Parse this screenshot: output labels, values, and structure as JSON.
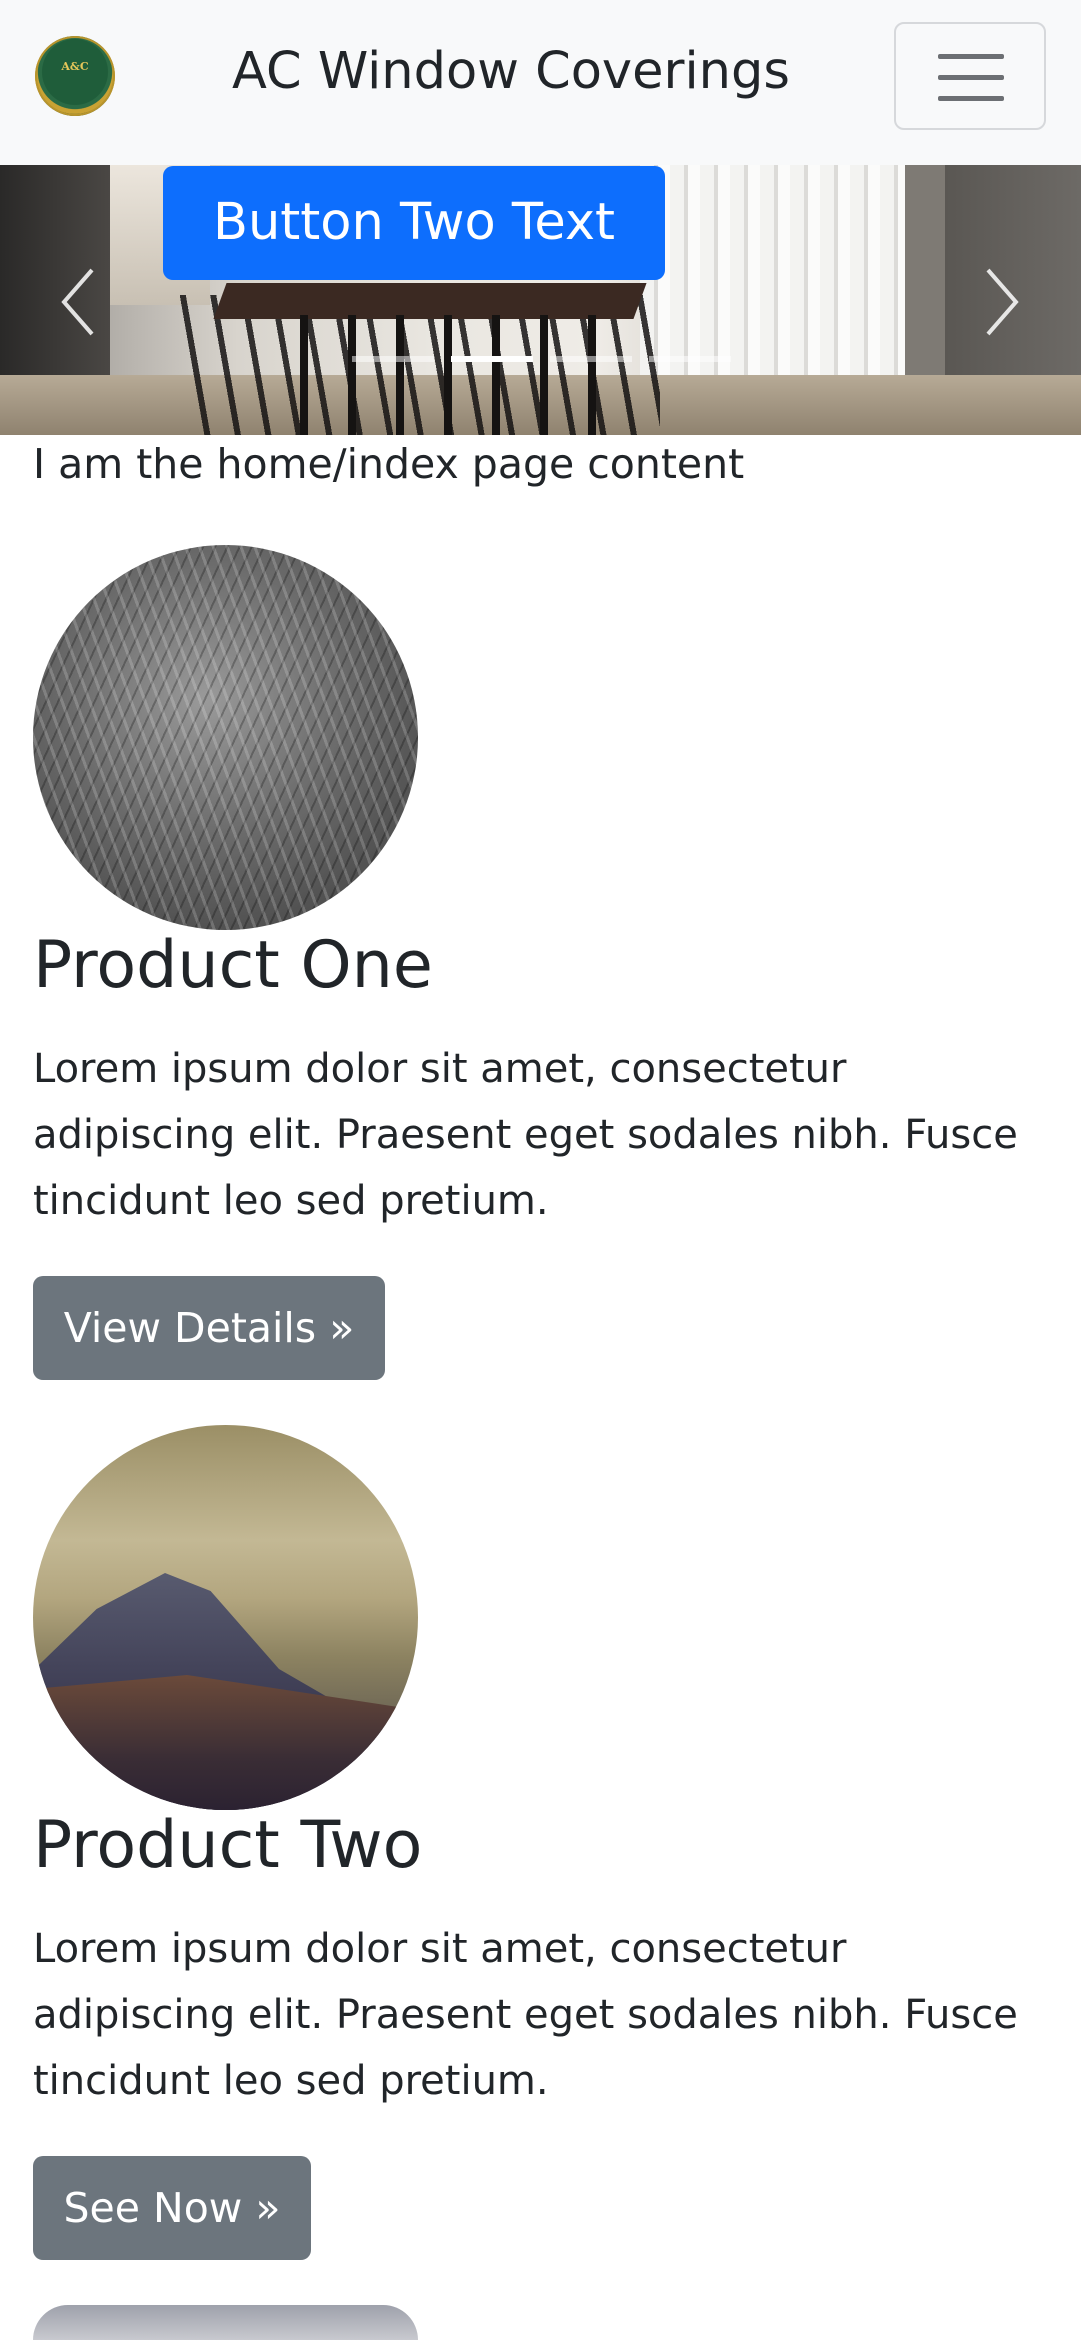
{
  "navbar": {
    "logo_text": "A&C",
    "brand": "AC Window Coverings",
    "toggler_icon": "hamburger-menu-icon"
  },
  "carousel": {
    "button_label": "Button Two Text",
    "prev_icon": "chevron-left-icon",
    "next_icon": "chevron-right-icon",
    "indicator_count": 4,
    "active_indicator": 2
  },
  "main": {
    "intro_text": "I am the home/index page content",
    "products": [
      {
        "title": "Product One",
        "description": "Lorem ipsum dolor sit amet, consectetur adipiscing elit. Praesent eget sodales nibh. Fusce tincidunt leo sed pretium.",
        "button_label": "View Details »"
      },
      {
        "title": "Product Two",
        "description": "Lorem ipsum dolor sit amet, consectetur adipiscing elit. Praesent eget sodales nibh. Fusce tincidunt leo sed pretium.",
        "button_label": "See Now »"
      }
    ]
  },
  "colors": {
    "primary": "#0d6efd",
    "secondary": "#6c757d",
    "navbar_bg": "#f8f9fa",
    "text": "#212529"
  }
}
